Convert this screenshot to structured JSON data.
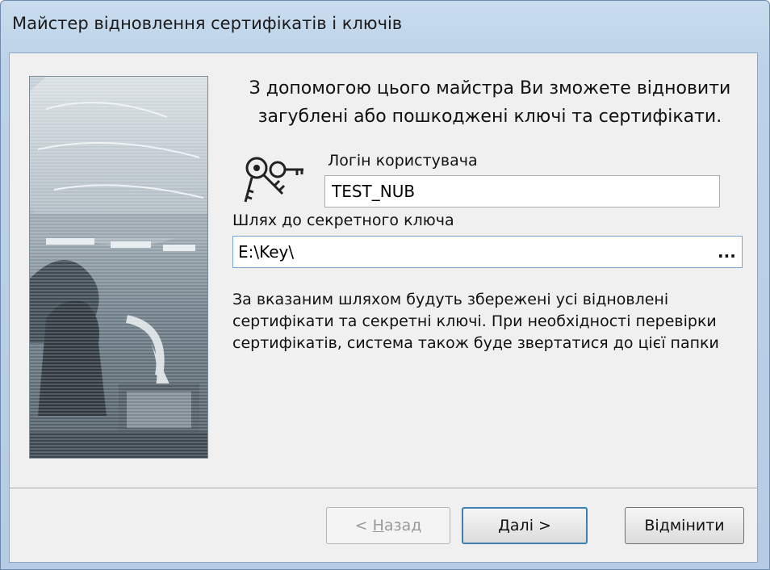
{
  "window": {
    "title": "Майстер відновлення сертифікатів і ключів"
  },
  "intro_text": "З допомогою цього майстра Ви зможете відновити загублені або пошкоджені ключі та сертифікати.",
  "login": {
    "label": "Логін користувача",
    "value": "TEST_NUB"
  },
  "key_path": {
    "label": "Шлях до секретного ключа",
    "value": "E:\\Key\\",
    "browse_label": "..."
  },
  "description": "За вказаним шляхом будуть збережені усі відновлені сертифікати та секретні ключі. При необхідності перевірки сертифікатів, система також буде звертатися до цієї папки",
  "buttons": {
    "back": {
      "prefix": "< ",
      "mnemonic": "Н",
      "rest": "азад"
    },
    "next": {
      "mnemonic": "Д",
      "rest": "алі >"
    },
    "cancel": "Відмінити"
  },
  "icons": {
    "keys": "keys-icon"
  },
  "colors": {
    "title_bar": "#c9dcef",
    "client_bg": "#f0f0f0",
    "default_button_border": "#3c7fb1"
  }
}
